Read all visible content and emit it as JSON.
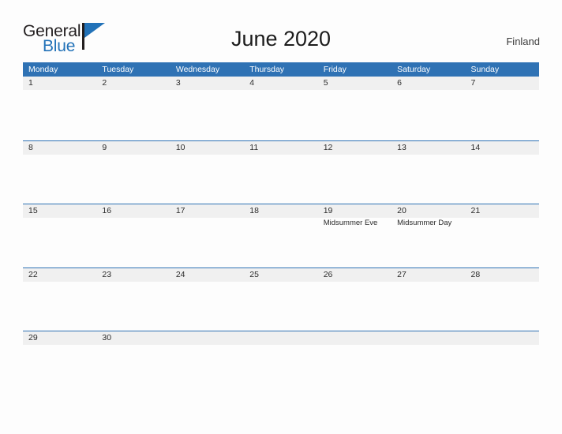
{
  "brand": {
    "name_top": "General",
    "name_bottom": "Blue",
    "flag_icon": "triangle-flag-icon",
    "color_primary": "#2272b8",
    "color_dark": "#231f20"
  },
  "header": {
    "title": "June 2020",
    "country": "Finland"
  },
  "calendar": {
    "header_color": "#2f72b4",
    "band_color": "#f0f0f0",
    "weekdays": [
      "Monday",
      "Tuesday",
      "Wednesday",
      "Thursday",
      "Friday",
      "Saturday",
      "Sunday"
    ],
    "weeks": [
      [
        {
          "day": "1",
          "events": []
        },
        {
          "day": "2",
          "events": []
        },
        {
          "day": "3",
          "events": []
        },
        {
          "day": "4",
          "events": []
        },
        {
          "day": "5",
          "events": []
        },
        {
          "day": "6",
          "events": []
        },
        {
          "day": "7",
          "events": []
        }
      ],
      [
        {
          "day": "8",
          "events": []
        },
        {
          "day": "9",
          "events": []
        },
        {
          "day": "10",
          "events": []
        },
        {
          "day": "11",
          "events": []
        },
        {
          "day": "12",
          "events": []
        },
        {
          "day": "13",
          "events": []
        },
        {
          "day": "14",
          "events": []
        }
      ],
      [
        {
          "day": "15",
          "events": []
        },
        {
          "day": "16",
          "events": []
        },
        {
          "day": "17",
          "events": []
        },
        {
          "day": "18",
          "events": []
        },
        {
          "day": "19",
          "events": [
            "Midsummer Eve"
          ]
        },
        {
          "day": "20",
          "events": [
            "Midsummer Day"
          ]
        },
        {
          "day": "21",
          "events": []
        }
      ],
      [
        {
          "day": "22",
          "events": []
        },
        {
          "day": "23",
          "events": []
        },
        {
          "day": "24",
          "events": []
        },
        {
          "day": "25",
          "events": []
        },
        {
          "day": "26",
          "events": []
        },
        {
          "day": "27",
          "events": []
        },
        {
          "day": "28",
          "events": []
        }
      ],
      [
        {
          "day": "29",
          "events": []
        },
        {
          "day": "30",
          "events": []
        },
        {
          "day": "",
          "events": []
        },
        {
          "day": "",
          "events": []
        },
        {
          "day": "",
          "events": []
        },
        {
          "day": "",
          "events": []
        },
        {
          "day": "",
          "events": []
        }
      ]
    ]
  }
}
